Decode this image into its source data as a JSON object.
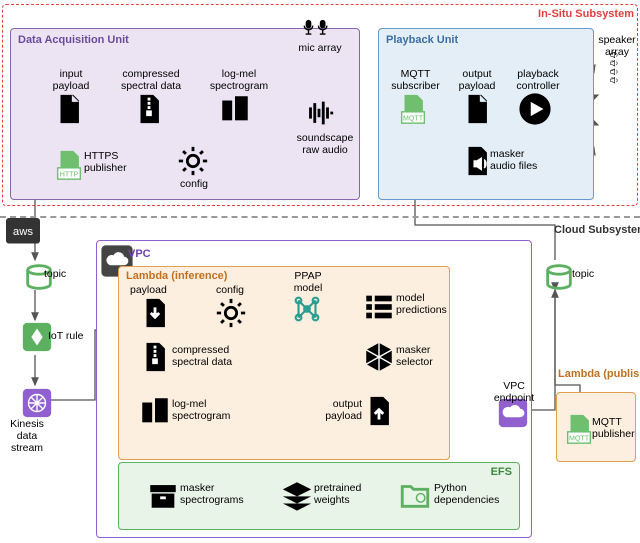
{
  "subsystems": {
    "insitu": "In-Situ Subsystem",
    "cloud": "Cloud Subsystem"
  },
  "units": {
    "daq": "Data Acquisition Unit",
    "playback": "Playback Unit",
    "vpc": "VPC",
    "lambda_inf": "Lambda (inference)",
    "lambda_pub": "Lambda (publisher)",
    "efs": "EFS"
  },
  "nodes": {
    "mic_array": "mic array",
    "speaker_array": "speaker array",
    "input_payload": "input\npayload",
    "compressed_spectral": "compressed\nspectral data",
    "logmel": "log-mel\nspectrogram",
    "soundscape": "soundscape\nraw audio",
    "https_pub": "HTTPS\npublisher",
    "config_daq": "config",
    "mqtt_sub": "MQTT\nsubscriber",
    "output_payload_pb": "output\npayload",
    "playback_ctrl": "playback\ncontroller",
    "masker_files": "masker\naudio files",
    "aws": "aws",
    "topic1": "topic",
    "iot_rule": "IoT rule",
    "kinesis": "Kinesis\ndata\nstream",
    "payload": "payload",
    "config_lambda": "config",
    "ppap": "PPAP\nmodel",
    "compressed2": "compressed\nspectral data",
    "logmel2": "log-mel\nspectrogram",
    "model_pred": "model\npredictions",
    "masker_sel": "masker\nselector",
    "output_payload": "output\npayload",
    "vpc_endpoint": "VPC\nendpoint",
    "topic2": "topic",
    "mqtt_pub": "MQTT\npublisher",
    "masker_spec": "masker\nspectrograms",
    "pretrained": "pretrained\nweights",
    "python_deps": "Python\ndependencies"
  },
  "colors": {
    "daq": "#8866aa",
    "play": "#6699cc",
    "cloud_vpc": "#9060d0",
    "lambda": "#e0a050",
    "efs": "#5cb060",
    "insitu": "#e04040",
    "http": "#6fbf6f",
    "mqtt": "#6fbf6f",
    "iot": "#5cb060",
    "kinesis": "#9060d0",
    "ppap": "#2a9d8f",
    "endpoint": "#9060d0"
  }
}
